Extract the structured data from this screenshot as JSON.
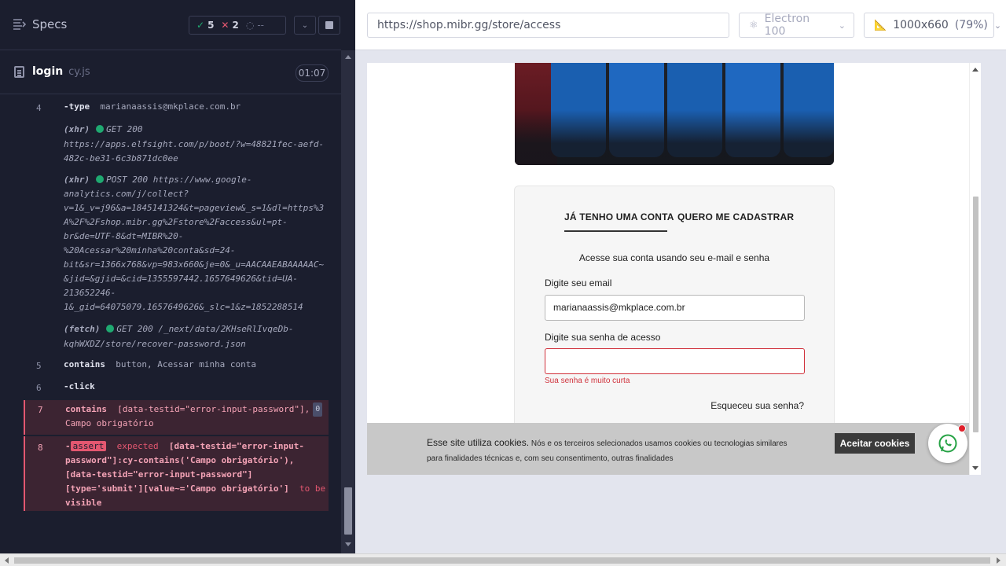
{
  "runner": {
    "specs_label": "Specs",
    "stats": {
      "passed": "5",
      "failed": "2",
      "pending": "--"
    },
    "file": {
      "name": "login",
      "ext": "cy.js",
      "duration": "01:07"
    }
  },
  "log": {
    "cmd4": {
      "num": "4",
      "name": "-type",
      "arg": "marianaassis@mkplace.com.br",
      "xhr1_kind": "(xhr)",
      "xhr1_status": "GET 200",
      "xhr1_url_l1": "https://apps.elfsight.com/p/boot/?w=48821fec-aefd-",
      "xhr1_url_l2": "482c-be31-6c3b871dc0ee",
      "xhr2_kind": "(xhr)",
      "xhr2_l1": "POST 200 https://www.google-",
      "xhr2_l2": "analytics.com/j/collect?",
      "xhr2_l3": "v=1&_v=j96&a=1845141324&t=pageview&_s=1&dl=https%3",
      "xhr2_l4": "A%2F%2Fshop.mibr.gg%2Fstore%2Faccess&ul=pt-",
      "xhr2_l5": "br&de=UTF-8&dt=MIBR%20-",
      "xhr2_l6": "%20Acessar%20minha%20conta&sd=24-",
      "xhr2_l7": "bit&sr=1366x768&vp=983x660&je=0&_u=AACAAEABAAAAAC~",
      "xhr2_l8": "&jid=&gjid=&cid=1355597442.1657649626&tid=UA-",
      "xhr2_l9": "213652246-",
      "xhr2_l10": "1&_gid=64075079.1657649626&_slc=1&z=1852288514",
      "fetch_kind": "(fetch)",
      "fetch_l1": "GET 200 /_next/data/2KHseRlIvqeDb-",
      "fetch_l2": "kqhWXDZ/store/recover-password.json"
    },
    "cmd5": {
      "num": "5",
      "name": "contains",
      "arg": "button, Acessar minha conta"
    },
    "cmd6": {
      "num": "6",
      "name": "-click"
    },
    "cmd7": {
      "num": "7",
      "name": "contains",
      "arg_l1": "[data-testid=\"error-input-password\"],",
      "arg_l2": "Campo obrigatório",
      "badge": "0"
    },
    "cmd8": {
      "num": "8",
      "dash": "-",
      "tag": "assert",
      "expected": "expected",
      "l1": "[data-testid=\"error-input-",
      "l2": "password\"]:cy-contains('Campo obrigatório'),",
      "l3": "[data-testid=\"error-input-password\"]",
      "l4": "[type='submit'][value~='Campo obrigatório']",
      "tobe": "to be",
      "l5": "visible"
    }
  },
  "aut": {
    "url": "https://shop.mibr.gg/store/access",
    "browser": "Electron 100",
    "viewport": "1000x660",
    "zoom": "(79%)"
  },
  "page": {
    "tabs": {
      "login": "JÁ TENHO UMA CONTA",
      "register": "QUERO ME CADASTRAR"
    },
    "subtitle": "Acesse sua conta usando seu e-mail e senha",
    "email_label": "Digite seu email",
    "email_value": "marianaassis@mkplace.com.br",
    "password_label": "Digite sua senha de acesso",
    "password_value": "",
    "password_error": "Sua senha é muito curta",
    "forgot": "Esqueceu sua senha?",
    "cookie_title": "Esse site utiliza cookies.",
    "cookie_text_l1": "Nós e os terceiros selecionados usamos cookies ou tecnologias similares",
    "cookie_text_l2": "para finalidades técnicas e, com seu consentimento, outras finalidades",
    "cookie_accept": "Aceitar cookies"
  },
  "colors": {
    "runner_bg": "#1b1e2e",
    "passed": "#1fa971",
    "failed": "#e45770",
    "error_red": "#d0313b"
  },
  "icons": {
    "specs": "list-icon",
    "passed": "check-icon",
    "failed": "x-icon",
    "pending": "spinner-icon",
    "whatsapp": "whatsapp-icon"
  }
}
